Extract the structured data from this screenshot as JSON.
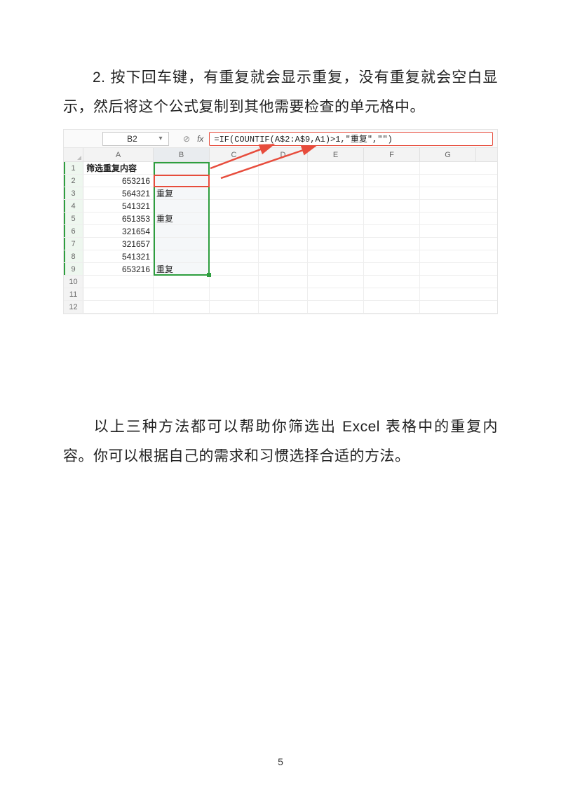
{
  "paragraph1": "2. 按下回车键，有重复就会显示重复，没有重复就会空白显示，然后将这个公式复制到其他需要检查的单元格中。",
  "paragraph2": "以上三种方法都可以帮助你筛选出 Excel 表格中的重复内容。你可以根据自己的需求和习惯选择合适的方法。",
  "page_number": "5",
  "screenshot": {
    "namebox": "B2",
    "fx_label": "fx",
    "cancel_glyph": "⊘",
    "formula": "=IF(COUNTIF(A$2:A$9,A1)>1,\"重复\",\"\")",
    "column_headers": [
      "A",
      "B",
      "C",
      "D",
      "E",
      "F",
      "G"
    ],
    "row_headers": [
      "1",
      "2",
      "3",
      "4",
      "5",
      "6",
      "7",
      "8",
      "9",
      "10",
      "11",
      "12"
    ],
    "header_cell": "筛选重复内容",
    "rows": [
      {
        "a": "653216",
        "b": ""
      },
      {
        "a": "564321",
        "b": "重复"
      },
      {
        "a": "541321",
        "b": ""
      },
      {
        "a": "651353",
        "b": "重复"
      },
      {
        "a": "321654",
        "b": ""
      },
      {
        "a": "321657",
        "b": ""
      },
      {
        "a": "541321",
        "b": ""
      },
      {
        "a": "653216",
        "b": "重复"
      }
    ]
  }
}
